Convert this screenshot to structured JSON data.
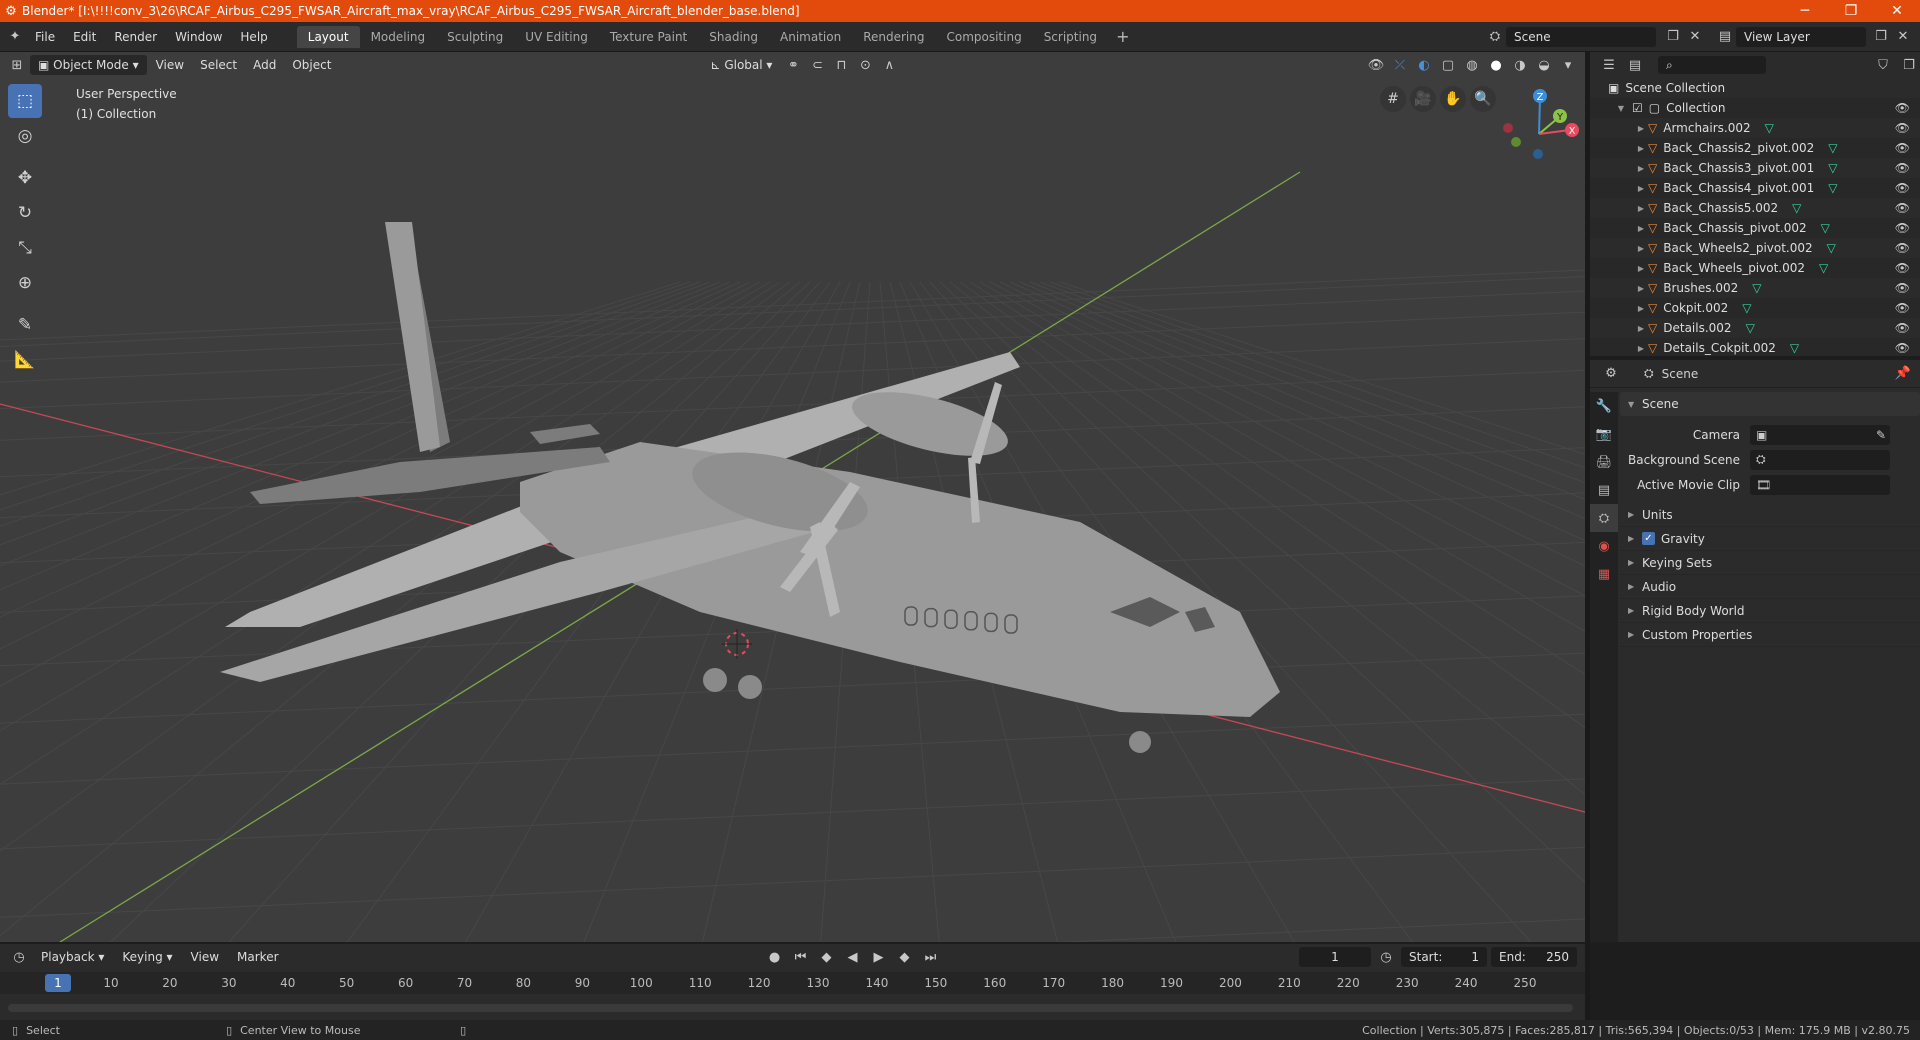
{
  "window": {
    "title": "Blender* [I:\\!!!!conv_3\\26\\RCAF_Airbus_C295_FWSAR_Aircraft_max_vray\\RCAF_Airbus_C295_FWSAR_Aircraft_blender_base.blend]",
    "minimize": "─",
    "maximize": "❐",
    "close": "✕"
  },
  "menubar": {
    "items": [
      "File",
      "Edit",
      "Render",
      "Window",
      "Help"
    ]
  },
  "workspaces": {
    "tabs": [
      "Layout",
      "Modeling",
      "Sculpting",
      "UV Editing",
      "Texture Paint",
      "Shading",
      "Animation",
      "Rendering",
      "Compositing",
      "Scripting"
    ],
    "active": "Layout",
    "add": "+"
  },
  "scene_selector": {
    "value": "Scene"
  },
  "view_layer": {
    "value": "View Layer"
  },
  "viewport": {
    "mode": "Object Mode",
    "menus": [
      "View",
      "Select",
      "Add",
      "Object"
    ],
    "orientation": "Global",
    "perspective_label": "User Perspective",
    "collection_label": "(1) Collection",
    "gizmo": {
      "x": "X",
      "y": "Y",
      "z": "Z"
    },
    "colors": {
      "x": "#e84a5f",
      "y": "#8bc34a",
      "z": "#3b8ed8",
      "grid": "#474747",
      "bg": "#3d3d3d"
    }
  },
  "toolbar": {
    "tools": [
      {
        "name": "select-box-tool",
        "glyph": "⬚",
        "active": true
      },
      {
        "name": "cursor-tool",
        "glyph": "◎",
        "active": false
      },
      {
        "name": "move-tool",
        "glyph": "✥",
        "active": false
      },
      {
        "name": "rotate-tool",
        "glyph": "↻",
        "active": false
      },
      {
        "name": "scale-tool",
        "glyph": "⤡",
        "active": false
      },
      {
        "name": "transform-tool",
        "glyph": "⊕",
        "active": false
      },
      {
        "name": "annotate-tool",
        "glyph": "✎",
        "active": false
      },
      {
        "name": "measure-tool",
        "glyph": "📐",
        "active": false
      }
    ]
  },
  "outliner": {
    "root": "Scene Collection",
    "collection": "Collection",
    "items": [
      "Armchairs.002",
      "Back_Chassis2_pivot.002",
      "Back_Chassis3_pivot.001",
      "Back_Chassis4_pivot.001",
      "Back_Chassis5.002",
      "Back_Chassis_pivot.002",
      "Back_Wheels2_pivot.002",
      "Back_Wheels_pivot.002",
      "Brushes.002",
      "Cokpit.002",
      "Details.002",
      "Details_Cokpit.002"
    ]
  },
  "properties": {
    "context": "Scene",
    "panel_title": "Scene",
    "fields": [
      {
        "label": "Camera",
        "value": ""
      },
      {
        "label": "Background Scene",
        "value": ""
      },
      {
        "label": "Active Movie Clip",
        "value": ""
      }
    ],
    "sections": [
      {
        "label": "Units",
        "checkbox": false
      },
      {
        "label": "Gravity",
        "checkbox": true
      },
      {
        "label": "Keying Sets",
        "checkbox": false
      },
      {
        "label": "Audio",
        "checkbox": false
      },
      {
        "label": "Rigid Body World",
        "checkbox": false
      },
      {
        "label": "Custom Properties",
        "checkbox": false
      }
    ]
  },
  "timeline": {
    "menus": [
      "Playback",
      "Keying",
      "View",
      "Marker"
    ],
    "current_frame": "1",
    "start_label": "Start:",
    "start": "1",
    "end_label": "End:",
    "end": "250",
    "ticks": [
      "1",
      "10",
      "20",
      "30",
      "40",
      "50",
      "60",
      "70",
      "80",
      "90",
      "100",
      "110",
      "120",
      "130",
      "140",
      "150",
      "160",
      "170",
      "180",
      "190",
      "200",
      "210",
      "220",
      "230",
      "240",
      "250"
    ]
  },
  "statusbar": {
    "select": "Select",
    "center_view": "Center View to Mouse",
    "stats": "Collection | Verts:305,875 | Faces:285,817 | Tris:565,394 | Objects:0/53 | Mem: 175.9 MB | v2.80.75"
  }
}
